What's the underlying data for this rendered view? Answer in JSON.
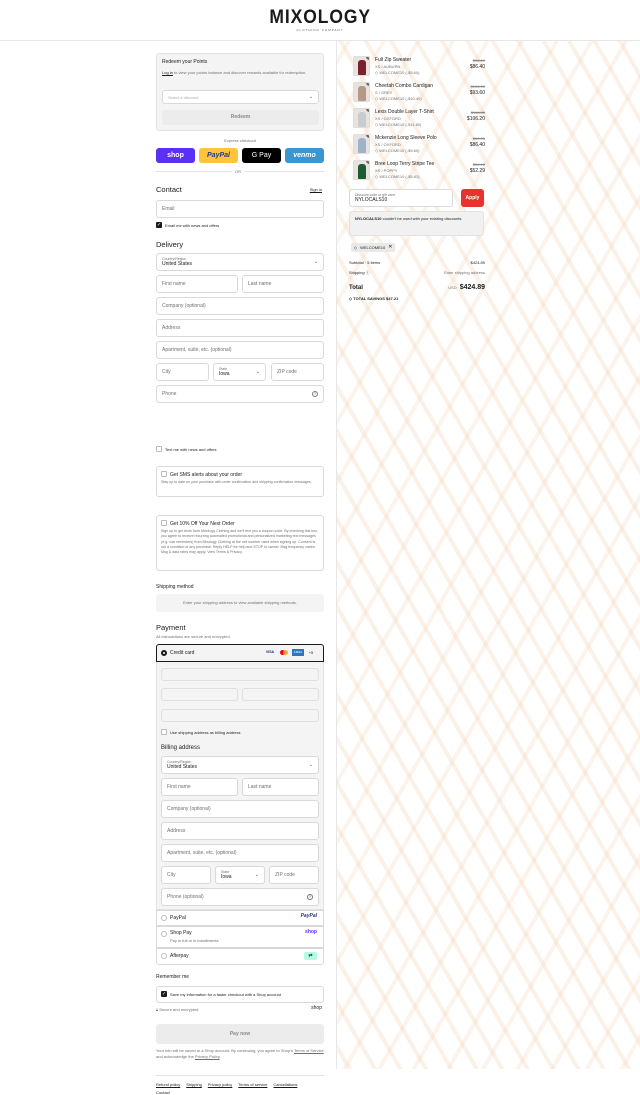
{
  "brand": {
    "name": "MIXOLOGY",
    "tagline": "CLOTHING COMPANY"
  },
  "rewards": {
    "title": "Redeem your Points",
    "login_link": "Log in",
    "desc_rest": " to view your points balance and discover rewards available for redemption.",
    "select_placeholder": "Select a discount",
    "redeem_label": "Redeem"
  },
  "express": {
    "title": "Express checkout",
    "shop": "shop",
    "paypal": "PayPal",
    "gpay": "G Pay",
    "venmo": "venmo",
    "or": "OR"
  },
  "contact": {
    "title": "Contact",
    "sign_in": "Sign in",
    "email_placeholder": "Email",
    "news_label": "Email me with news and offers"
  },
  "delivery": {
    "title": "Delivery",
    "country_label": "Country/Region",
    "country_value": "United States",
    "first_name": "First name",
    "last_name": "Last name",
    "company": "Company (optional)",
    "address": "Address",
    "apartment": "Apartment, suite, etc. (optional)",
    "city": "City",
    "state_label": "State",
    "state_value": "Iowa",
    "zip": "ZIP code",
    "phone": "Phone",
    "text_label": "Text me with news and offers"
  },
  "sms": {
    "title": "Get SMS alerts about your order",
    "desc": "Stay up to date on your purchase with order confirmation and shipping confirmation messages."
  },
  "promo": {
    "title": "Get 10% Off Your Next Order",
    "desc": "Sign up to get texts from Mixology Clothing and we'll text you a coupon code. By checking this box, you agree to receive recurring automated promotional and personalized marketing text messages (e.g. cart reminders) from Mixology Clothing at the cell number used when signing up. Consent is not a condition of any purchase. Reply HELP for help and STOP to cancel. Msg frequency varies. Msg & data rates may apply. View Terms & Privacy."
  },
  "shipping_method": {
    "title": "Shipping method",
    "message": "Enter your shipping address to view available shipping methods."
  },
  "payment": {
    "title": "Payment",
    "subtitle": "All transactions are secure and encrypted.",
    "credit_card": "Credit card",
    "cards": [
      "VISA",
      "MC",
      "AMEX",
      "+5"
    ],
    "billing_same": "Use shipping address as billing address",
    "billing_title": "Billing address",
    "country_label": "Country/Region",
    "country_value": "United States",
    "first_name": "First name",
    "last_name": "Last name",
    "company": "Company (optional)",
    "address": "Address",
    "apartment": "Apartment, suite, etc. (optional)",
    "city": "City",
    "state_label": "State",
    "state_value": "Iowa",
    "zip": "ZIP code",
    "phone": "Phone (optional)",
    "paypal": "PayPal",
    "paypal_logo": "PayPal",
    "shoppay": "Shop Pay",
    "shoppay_sub": "Pay in full or in installments",
    "shoppay_logo": "shop",
    "afterpay": "Afterpay"
  },
  "remember": {
    "title": "Remember me",
    "label": "Save my information for a faster checkout with a Shop account",
    "secure": "Secure and encrypted",
    "shop_logo": "shop"
  },
  "pay_now": "Pay now",
  "legal": {
    "text1": "Your info will be saved to a Shop account. By continuing, you agree to Shop's ",
    "terms": "Terms of Service",
    "text2": " and acknowledge the ",
    "privacy": "Privacy Policy",
    "text3": "."
  },
  "footer_links": [
    "Refund policy",
    "Shipping",
    "Privacy policy",
    "Terms of service",
    "Cancellations",
    "Contact"
  ],
  "cart": {
    "items": [
      {
        "qty": "1",
        "name": "Full Zip Sweater",
        "variant": "XS / AUBURN",
        "discount": "WELCOME10 (-$9.60)",
        "old_price": "$96.00",
        "price": "$86.40",
        "color": "#7a2030"
      },
      {
        "qty": "1",
        "name": "Cheetah Combo Cardigan",
        "variant": "S / GREY",
        "discount": "WELCOME10 (-$10.40)",
        "old_price": "$104.00",
        "price": "$93.60",
        "color": "#b49a86"
      },
      {
        "qty": "1",
        "name": "Lexis Double Layer T-Shirt",
        "variant": "XS / OXFORD",
        "discount": "WELCOME10 (-$11.80)",
        "old_price": "$118.00",
        "price": "$106.20",
        "color": "#c8ccd0"
      },
      {
        "qty": "1",
        "name": "Mckenzie Long Sleeve Polo",
        "variant": "XS / OXFORD",
        "discount": "WELCOME10 (-$9.60)",
        "old_price": "$96.00",
        "price": "$86.40",
        "color": "#9fb3c8"
      },
      {
        "qty": "1",
        "name": "Bree Loop Terry Stripe Tee",
        "variant": "XS / POPPY",
        "discount": "WELCOME10 (-$5.81)",
        "old_price": "$58.10",
        "price": "$52.29",
        "color": "#1f5a32"
      }
    ],
    "discount_label": "Discount code or gift card",
    "discount_value": "NYLOCALS10",
    "apply": "Apply",
    "error_code": "NYLOCALS10",
    "error_rest": " couldn't be used with your existing discounts.",
    "tag": "WELCOME10",
    "subtotal_label": "Subtotal · 5 items",
    "subtotal": "$424.89",
    "shipping_label": "Shipping",
    "shipping_value": "Enter shipping address",
    "total_label": "Total",
    "currency": "USD",
    "total": "$424.89",
    "savings_label": "TOTAL SAVINGS",
    "savings": "$47.21"
  },
  "colors": {
    "shop": "#5a31f4",
    "paypal": "#ffc439",
    "gpay": "#000000",
    "venmo": "#3d95ce",
    "apply": "#e5342e"
  }
}
